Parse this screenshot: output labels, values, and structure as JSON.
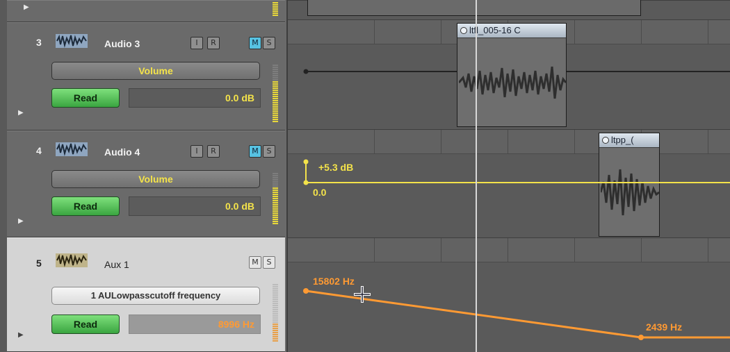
{
  "tracks": [
    {
      "number": "3",
      "name": "Audio 3",
      "btn_i": "I",
      "btn_r": "R",
      "btn_m": "M",
      "btn_s": "S",
      "param": "Volume",
      "mode": "Read",
      "value": "0.0 dB"
    },
    {
      "number": "4",
      "name": "Audio 4",
      "btn_i": "I",
      "btn_r": "R",
      "btn_m": "M",
      "btn_s": "S",
      "param": "Volume",
      "mode": "Read",
      "value": "0.0 dB"
    },
    {
      "number": "5",
      "name": "Aux 1",
      "btn_m": "M",
      "btn_s": "S",
      "param": "1 AULowpasscutoff frequency",
      "mode": "Read",
      "value": "8996 Hz"
    }
  ],
  "regions": [
    {
      "name": "ltfl_005-16 C"
    },
    {
      "name": "ltpp_("
    }
  ],
  "automation": {
    "audio4_top": "+5.3 dB",
    "audio4_bottom": "0.0",
    "aux_start": "15802 Hz",
    "aux_end": "2439 Hz"
  },
  "colors": {
    "volume_line": "#f4e34a",
    "filter_line": "#ff9a33",
    "mute_on": "#57c2e2",
    "read_green": "#3aa540"
  }
}
